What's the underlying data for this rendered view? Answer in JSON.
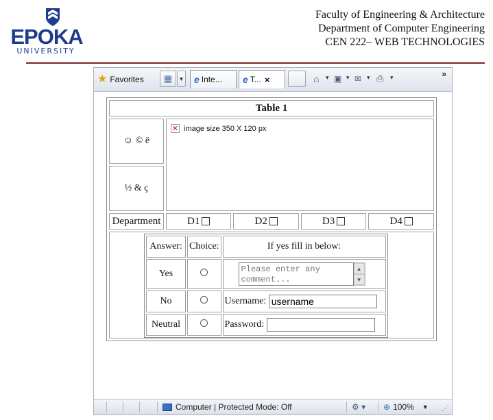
{
  "header": {
    "logo_word": "EPOKA",
    "logo_sub": "UNIVERSITY",
    "lines": [
      "Faculty of Engineering & Architecture",
      "Department of Computer Engineering",
      "CEN 222– WEB TECHNOLOGIES"
    ]
  },
  "browser": {
    "favorites_label": "Favorites",
    "tabs": [
      {
        "label": "Inte..."
      },
      {
        "label": "T..."
      }
    ],
    "tab_close": "×",
    "more": "»",
    "status": {
      "zone": "Computer | Protected Mode: Off",
      "zoom": "100%"
    }
  },
  "table1": {
    "caption": "Table 1",
    "symbols_top": "☺ © ë",
    "symbols_bottom": "½ & ç",
    "image_alt": "image size 350 X 120 px",
    "department_label": "Department",
    "departments": [
      "D1",
      "D2",
      "D3",
      "D4"
    ]
  },
  "table2": {
    "headers": {
      "answer": "Answer:",
      "choice": "Choice:",
      "fill": "If yes fill in below:"
    },
    "rows": [
      "Yes",
      "No",
      "Neutral"
    ],
    "comment_placeholder": "Please enter any comment...",
    "username_label": "Username:",
    "username_value": "username",
    "password_label": "Password:",
    "password_value": ""
  },
  "colors": {
    "brand": "#1e3c8c",
    "rule": "#7a2424"
  }
}
